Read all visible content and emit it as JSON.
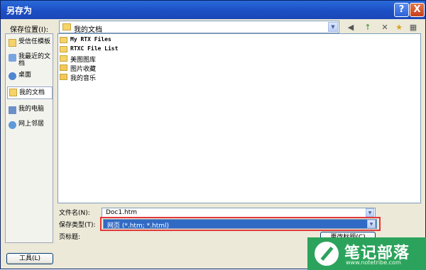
{
  "window": {
    "title": "另存为"
  },
  "titlebar": {
    "help": "?",
    "close": "X"
  },
  "save_in": {
    "label": "保存位置(I):",
    "value": "我的文档",
    "arrow": "▼"
  },
  "toolbar": {
    "back": "◀",
    "up": "↑",
    "delete": "✕",
    "new_folder": "★",
    "views": "▦"
  },
  "places": [
    {
      "label": "受信任模板",
      "icon": "folder-icon"
    },
    {
      "label": "我最近的文档",
      "icon": "recent-documents-icon"
    },
    {
      "label": "桌面",
      "icon": "desktop-icon"
    },
    {
      "label": "我的文档",
      "icon": "my-documents-icon"
    },
    {
      "label": "我的电脑",
      "icon": "my-computer-icon"
    },
    {
      "label": "网上邻居",
      "icon": "network-places-icon"
    }
  ],
  "files": [
    {
      "name": "My RTX Files",
      "icon": "folder-icon"
    },
    {
      "name": "RTXC File List",
      "icon": "folder-icon"
    },
    {
      "name": "美图图库",
      "icon": "folder-icon"
    },
    {
      "name": "图片收藏",
      "icon": "pictures-folder-icon"
    },
    {
      "name": "我的音乐",
      "icon": "music-folder-icon"
    }
  ],
  "filename": {
    "label": "文件名(N):",
    "value": "Doc1.htm"
  },
  "filetype": {
    "label": "保存类型(T):",
    "value": "网页 (*.htm; *.html)"
  },
  "page_title": {
    "label": "页标题:",
    "button": "更改标题(C)"
  },
  "tools_button": "工具(L)",
  "watermark": {
    "title": "笔记部落",
    "url": "www.notetribe.com"
  },
  "colors": {
    "titlebar": "#1c4fc4",
    "highlight": "#316ac5",
    "annotation": "#e2373b",
    "watermark": "#2ca35c"
  }
}
